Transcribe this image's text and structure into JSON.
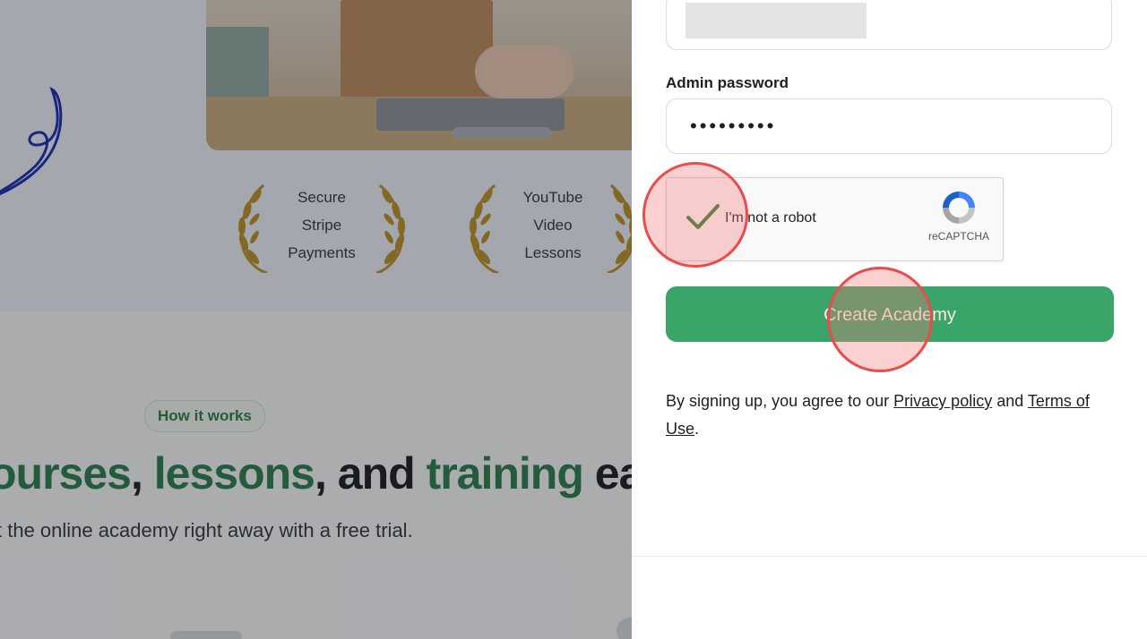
{
  "background": {
    "awards": [
      {
        "lines": [
          "Secure",
          "Stripe",
          "Payments"
        ]
      },
      {
        "lines": [
          "YouTube",
          "Video",
          "Lessons"
        ]
      }
    ],
    "how_it_works": "How it works",
    "headline": {
      "part1": "ourses",
      "sep1": ", ",
      "part2": "lessons",
      "sep2": ", and ",
      "part3": "training",
      "part4": " ea"
    },
    "subline": "t the online academy right away with a free trial."
  },
  "form": {
    "password_label": "Admin password",
    "password_value": "•••••••••",
    "captcha": {
      "label": "I'm not a robot",
      "brand": "reCAPTCHA",
      "checked": true
    },
    "create_button": "Create Academy",
    "terms": {
      "prefix": "By signing up, you agree to our ",
      "privacy": "Privacy policy",
      "middle": " and ",
      "terms_link": "Terms of Use",
      "suffix": "."
    }
  },
  "colors": {
    "accent_green": "#3aa569",
    "headline_green": "#2f7d4e",
    "marker_red": "#ea4b4b"
  }
}
